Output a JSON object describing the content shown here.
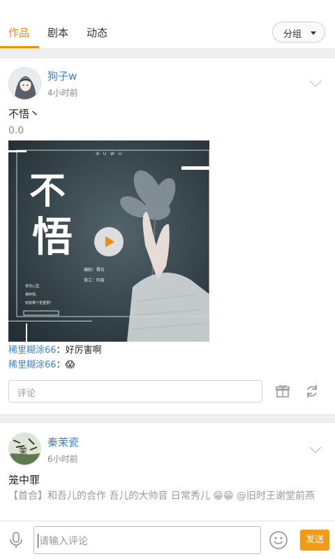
{
  "tabs": [
    {
      "label": "作品",
      "active": true
    },
    {
      "label": "剧本",
      "active": false
    },
    {
      "label": "动态",
      "active": false
    }
  ],
  "group_button": {
    "label": "分组"
  },
  "posts": [
    {
      "username": "狗子w",
      "time": "4小时前",
      "title": "不悟丶",
      "score": "0.0",
      "cover": {
        "top_text": "· B · U · W · U ·",
        "calligraphy": [
          "不",
          "悟"
        ],
        "credit_lines": [
          "编剧：稷告",
          "美工：阿麦"
        ],
        "small_lines": [
          "真你心里,",
          "推碎我,",
          "到底哪个更重要?"
        ]
      },
      "comments": [
        {
          "user": "稀里糊涂66",
          "text": "好厉害啊"
        },
        {
          "user": "稀里糊涂66",
          "text": "😱"
        }
      ],
      "comment_placeholder": "评论"
    },
    {
      "username": "秦茉瓷",
      "time": "6小时前",
      "title": "笼中罪",
      "description": "【首合】和吾儿的合作 吾儿的大帅音 日常秀儿 😁😁 @旧时王谢堂前燕"
    }
  ],
  "bottom": {
    "placeholder": "请输入评论",
    "send_label": "发送"
  },
  "colors": {
    "accent": "#f08b0c",
    "link": "#3b82d6",
    "send": "#f39a14"
  },
  "icons": [
    "gift-icon",
    "share-refresh-icon",
    "microphone-icon",
    "emoji-icon",
    "play-icon",
    "chevron-down-icon"
  ]
}
